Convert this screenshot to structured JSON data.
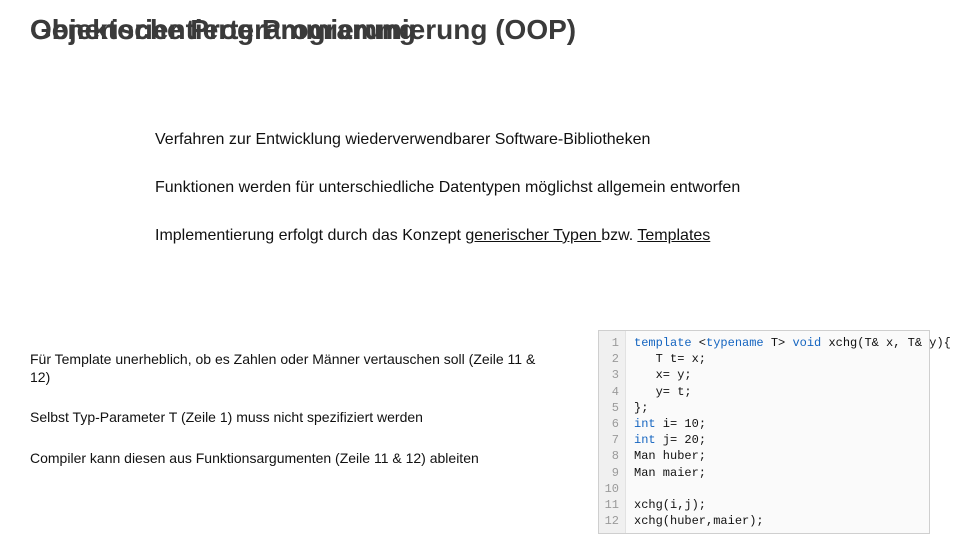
{
  "title_overlay": {
    "a": "Objektorientierte Programmierung (OOP)",
    "b": "Generische Programmierung"
  },
  "bullets": {
    "b1": "Verfahren zur Entwicklung wiederverwendbarer Software-Bibliotheken",
    "b2": "Funktionen werden für unterschiedliche Datentypen möglichst allgemein entworfen",
    "b3_pre": "Implementierung erfolgt durch das Konzept ",
    "b3_u1": "generischer Typen ",
    "b3_mid": "bzw. ",
    "b3_u2": "Templates"
  },
  "lower": {
    "p1": "Für Template unerheblich, ob es Zahlen oder Männer vertauschen soll (Zeile 11 & 12)",
    "p2": "Selbst Typ-Parameter T (Zeile 1) muss nicht spezifiziert werden",
    "p3": "Compiler kann diesen aus Funktionsargumenten (Zeile 11 & 12) ableiten"
  },
  "code": {
    "line_numbers": [
      "1",
      "2",
      "3",
      "4",
      "5",
      "6",
      "7",
      "8",
      "9",
      "10",
      "11",
      "12"
    ],
    "lines": [
      "template <typename T> void xchg(T& x, T& y){",
      "   T t= x;",
      "   x= y;",
      "   y= t;",
      "};",
      "int i= 10;",
      "int j= 20;",
      "Man huber;",
      "Man maier;",
      "",
      "xchg(i,j);",
      "xchg(huber,maier);"
    ]
  }
}
